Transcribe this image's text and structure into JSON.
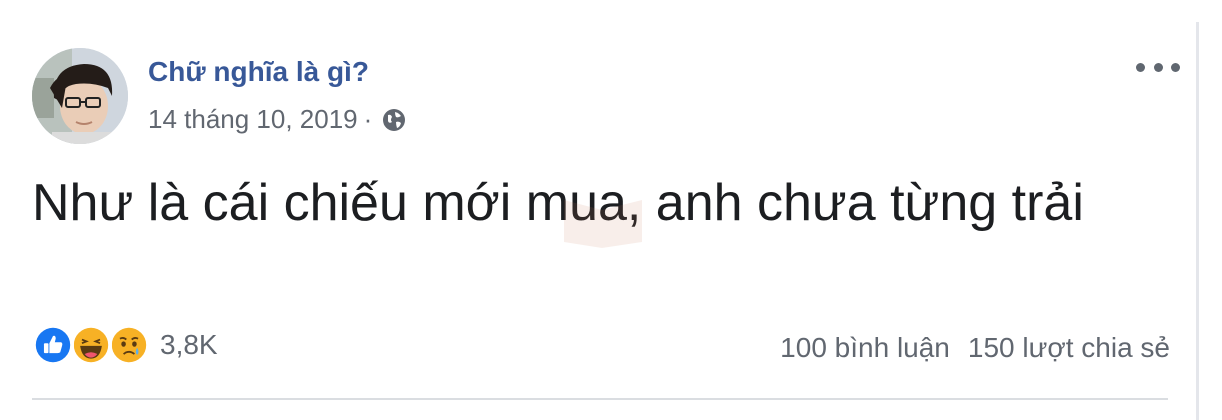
{
  "post": {
    "author": "Chữ nghĩa là gì?",
    "date": "14 tháng 10, 2019",
    "separator": "·",
    "privacy_icon": "globe-icon",
    "more_icon": "more-options-icon",
    "message": "Như là cái chiếu mới mua, anh chưa từng trải",
    "reactions": {
      "icons": [
        "like-icon",
        "haha-icon",
        "sad-icon"
      ],
      "count": "3,8K"
    },
    "comments": "100 bình luận",
    "shares": "150 lượt chia sẻ"
  },
  "colors": {
    "author": "#385898",
    "meta": "#616770",
    "like": "#1877f2",
    "emoji": "#f7b125"
  }
}
